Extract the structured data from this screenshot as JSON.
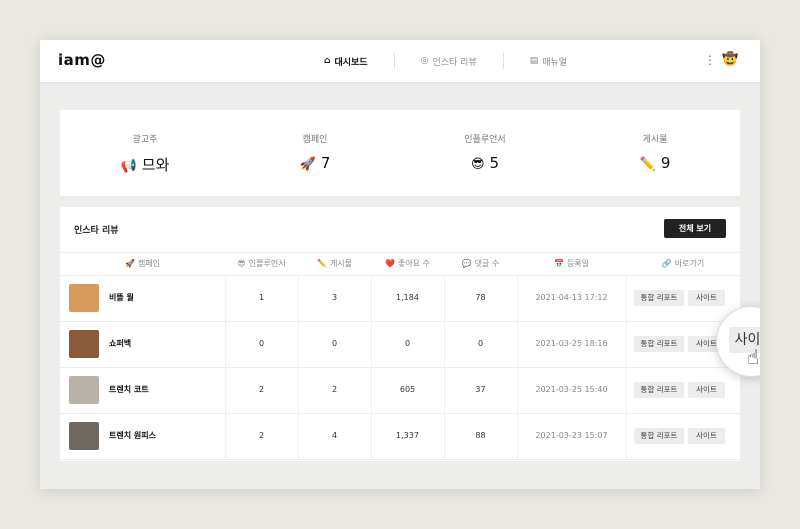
{
  "app": {
    "logo": "iam@"
  },
  "nav": [
    {
      "icon": "⌂",
      "label": "대시보드"
    },
    {
      "icon": "◎",
      "label": "인스타 리뷰"
    },
    {
      "icon": "▤",
      "label": "매뉴얼"
    }
  ],
  "stats": [
    {
      "label": "광고주",
      "emoji": "📢",
      "value": "므와"
    },
    {
      "label": "캠페인",
      "emoji": "🚀",
      "value": "7"
    },
    {
      "label": "인플루언서",
      "emoji": "😎",
      "value": "5"
    },
    {
      "label": "게시물",
      "emoji": "✏️",
      "value": "9"
    }
  ],
  "review": {
    "title": "인스타 리뷰",
    "view_all": "전체 보기",
    "headers": [
      {
        "emoji": "🚀",
        "label": "캠페인"
      },
      {
        "emoji": "😎",
        "label": "인플루언서"
      },
      {
        "emoji": "✏️",
        "label": "게시물"
      },
      {
        "emoji": "❤️",
        "label": "좋아요 수"
      },
      {
        "emoji": "💬",
        "label": "댓글 수"
      },
      {
        "emoji": "📅",
        "label": "등록일"
      },
      {
        "emoji": "🔗",
        "label": "바로가기"
      }
    ],
    "rows": [
      {
        "name": "비뜰 뭘",
        "influencers": "1",
        "posts": "3",
        "likes": "1,184",
        "comments": "78",
        "date": "2021-04-13 17:12",
        "report": "통합 리포트",
        "site": "사이트",
        "thumb": "#d89a5a"
      },
      {
        "name": "쇼퍼백",
        "influencers": "0",
        "posts": "0",
        "likes": "0",
        "comments": "0",
        "date": "2021-03-25 18:16",
        "report": "통합 리포트",
        "site": "사이트",
        "thumb": "#8a5a3a"
      },
      {
        "name": "트렌치 코트",
        "influencers": "2",
        "posts": "2",
        "likes": "605",
        "comments": "37",
        "date": "2021-03-25 15:40",
        "report": "통합 리포트",
        "site": "사이트",
        "thumb": "#b9b2a8"
      },
      {
        "name": "트렌치 원피스",
        "influencers": "2",
        "posts": "4",
        "likes": "1,337",
        "comments": "88",
        "date": "2021-03-23 15:07",
        "report": "통합 리포트",
        "site": "사이트",
        "thumb": "#6f6860"
      }
    ]
  },
  "magnifier": {
    "label": "사이트"
  }
}
